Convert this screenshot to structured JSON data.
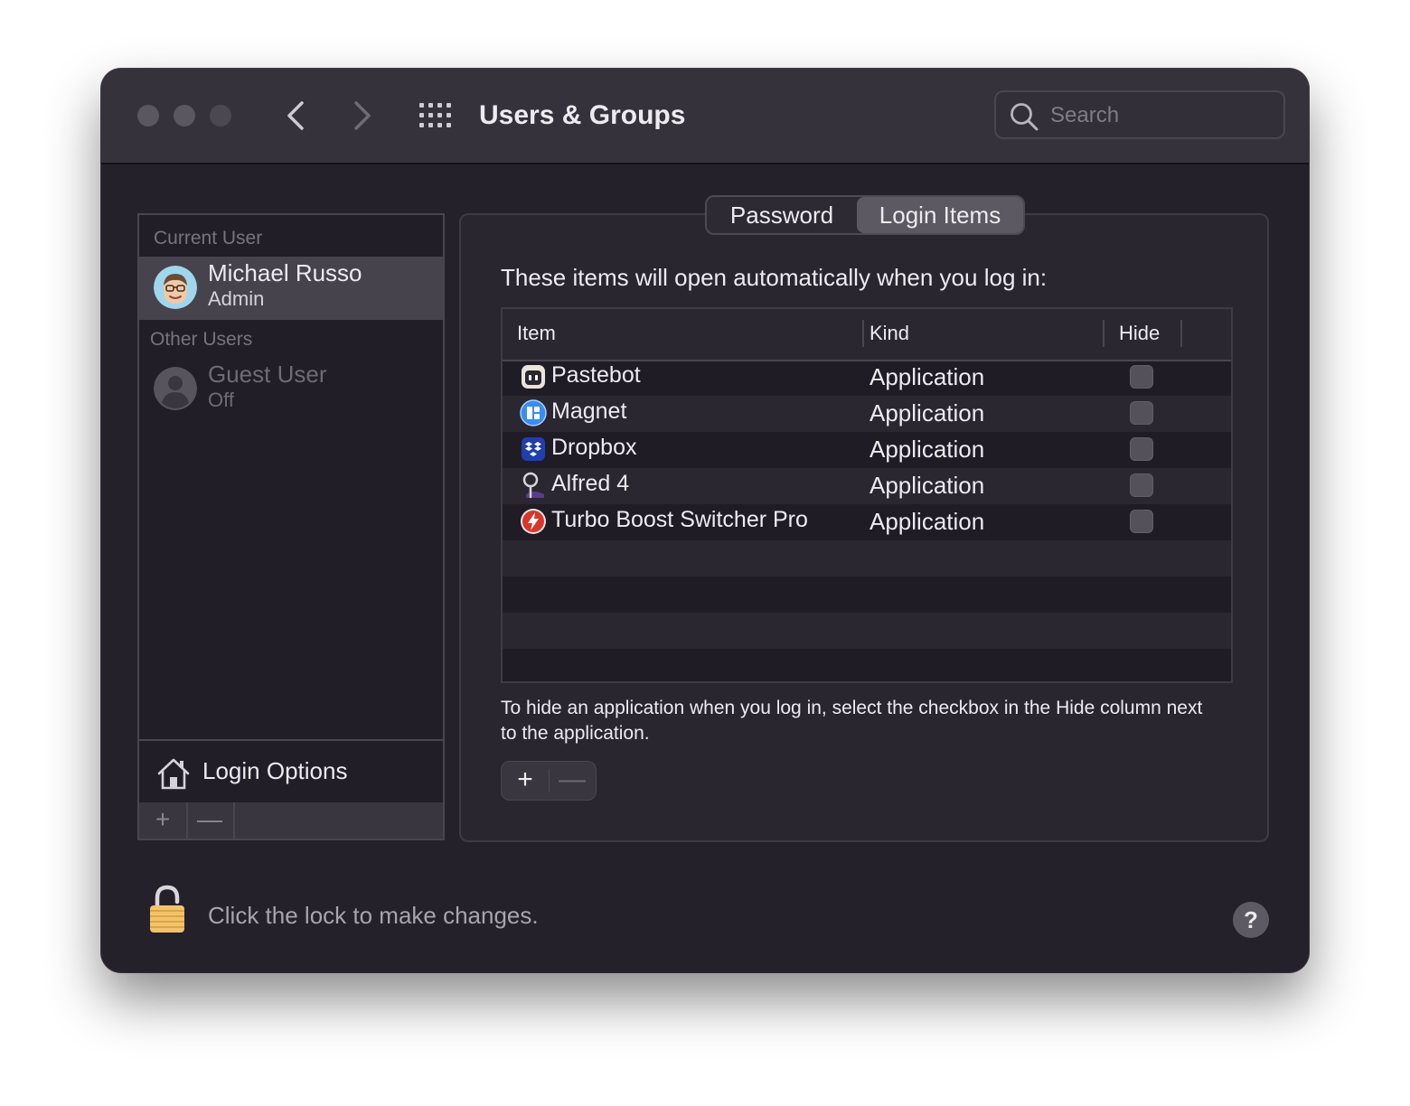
{
  "window": {
    "title": "Users & Groups",
    "search": {
      "placeholder": "Search",
      "value": ""
    }
  },
  "sidebar": {
    "current_user_header": "Current User",
    "current_user": {
      "name": "Michael Russo",
      "role": "Admin"
    },
    "other_users_header": "Other Users",
    "other_users": [
      {
        "name": "Guest User",
        "status": "Off"
      }
    ],
    "login_options_label": "Login Options",
    "add_label": "+",
    "remove_label": "—"
  },
  "tabs": [
    {
      "label": "Password",
      "selected": false
    },
    {
      "label": "Login Items",
      "selected": true
    }
  ],
  "login_items": {
    "intro": "These items will open automatically when you log in:",
    "columns": {
      "item": "Item",
      "kind": "Kind",
      "hide": "Hide"
    },
    "rows": [
      {
        "item": "Pastebot",
        "kind": "Application",
        "hide": false,
        "icon": "pastebot-icon"
      },
      {
        "item": "Magnet",
        "kind": "Application",
        "hide": false,
        "icon": "magnet-icon"
      },
      {
        "item": "Dropbox",
        "kind": "Application",
        "hide": false,
        "icon": "dropbox-icon"
      },
      {
        "item": "Alfred 4",
        "kind": "Application",
        "hide": false,
        "icon": "alfred-icon"
      },
      {
        "item": "Turbo Boost Switcher Pro",
        "kind": "Application",
        "hide": false,
        "icon": "turbo-boost-icon"
      }
    ],
    "hint": "To hide an application when you log in, select the checkbox in the Hide column next to the application.",
    "add_label": "+",
    "remove_label": "—"
  },
  "footer": {
    "lock_text": "Click the lock to make changes.",
    "help_label": "?"
  },
  "colors": {
    "window_bg": "#25212b",
    "titlebar_bg": "#36323b",
    "selection_bg": "#47434c",
    "text": "#eeeaf0"
  }
}
